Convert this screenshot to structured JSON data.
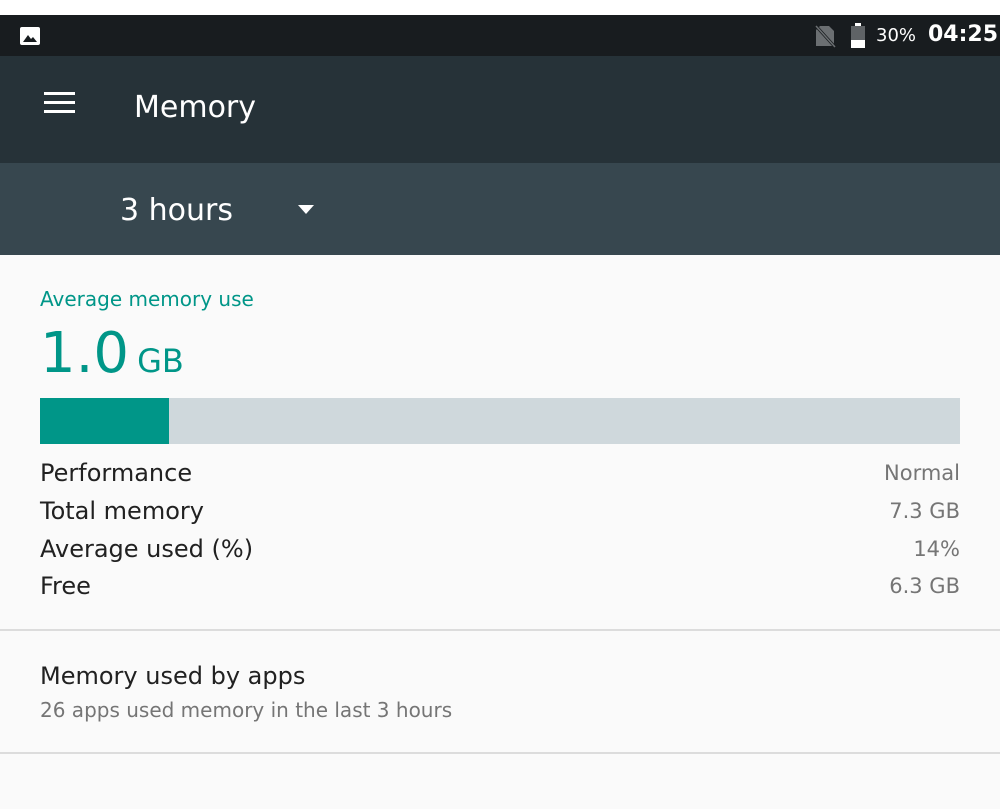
{
  "status_bar": {
    "battery_percent": "30%",
    "time": "04:25",
    "icons": [
      "gallery-icon",
      "no-sim-icon",
      "battery-icon"
    ]
  },
  "app_bar": {
    "title": "Memory",
    "nav_icon": "menu-icon"
  },
  "spinner": {
    "selected": "3 hours",
    "icon": "dropdown-caret-icon"
  },
  "summary": {
    "label": "Average memory use",
    "value": "1.0",
    "unit": "GB",
    "usage_fraction": 0.14
  },
  "stats": [
    {
      "label": "Performance",
      "value": "Normal"
    },
    {
      "label": "Total memory",
      "value": "7.3 GB"
    },
    {
      "label": "Average used (%)",
      "value": "14%"
    },
    {
      "label": "Free",
      "value": "6.3 GB"
    }
  ],
  "apps_item": {
    "title": "Memory used by apps",
    "subtitle": "26 apps used memory in the last 3 hours"
  },
  "colors": {
    "accent": "#009688",
    "app_bar": "#263238",
    "spinner_bar": "#37474f",
    "status_bar": "#181c1f",
    "progress_track": "#cfd8dc"
  }
}
